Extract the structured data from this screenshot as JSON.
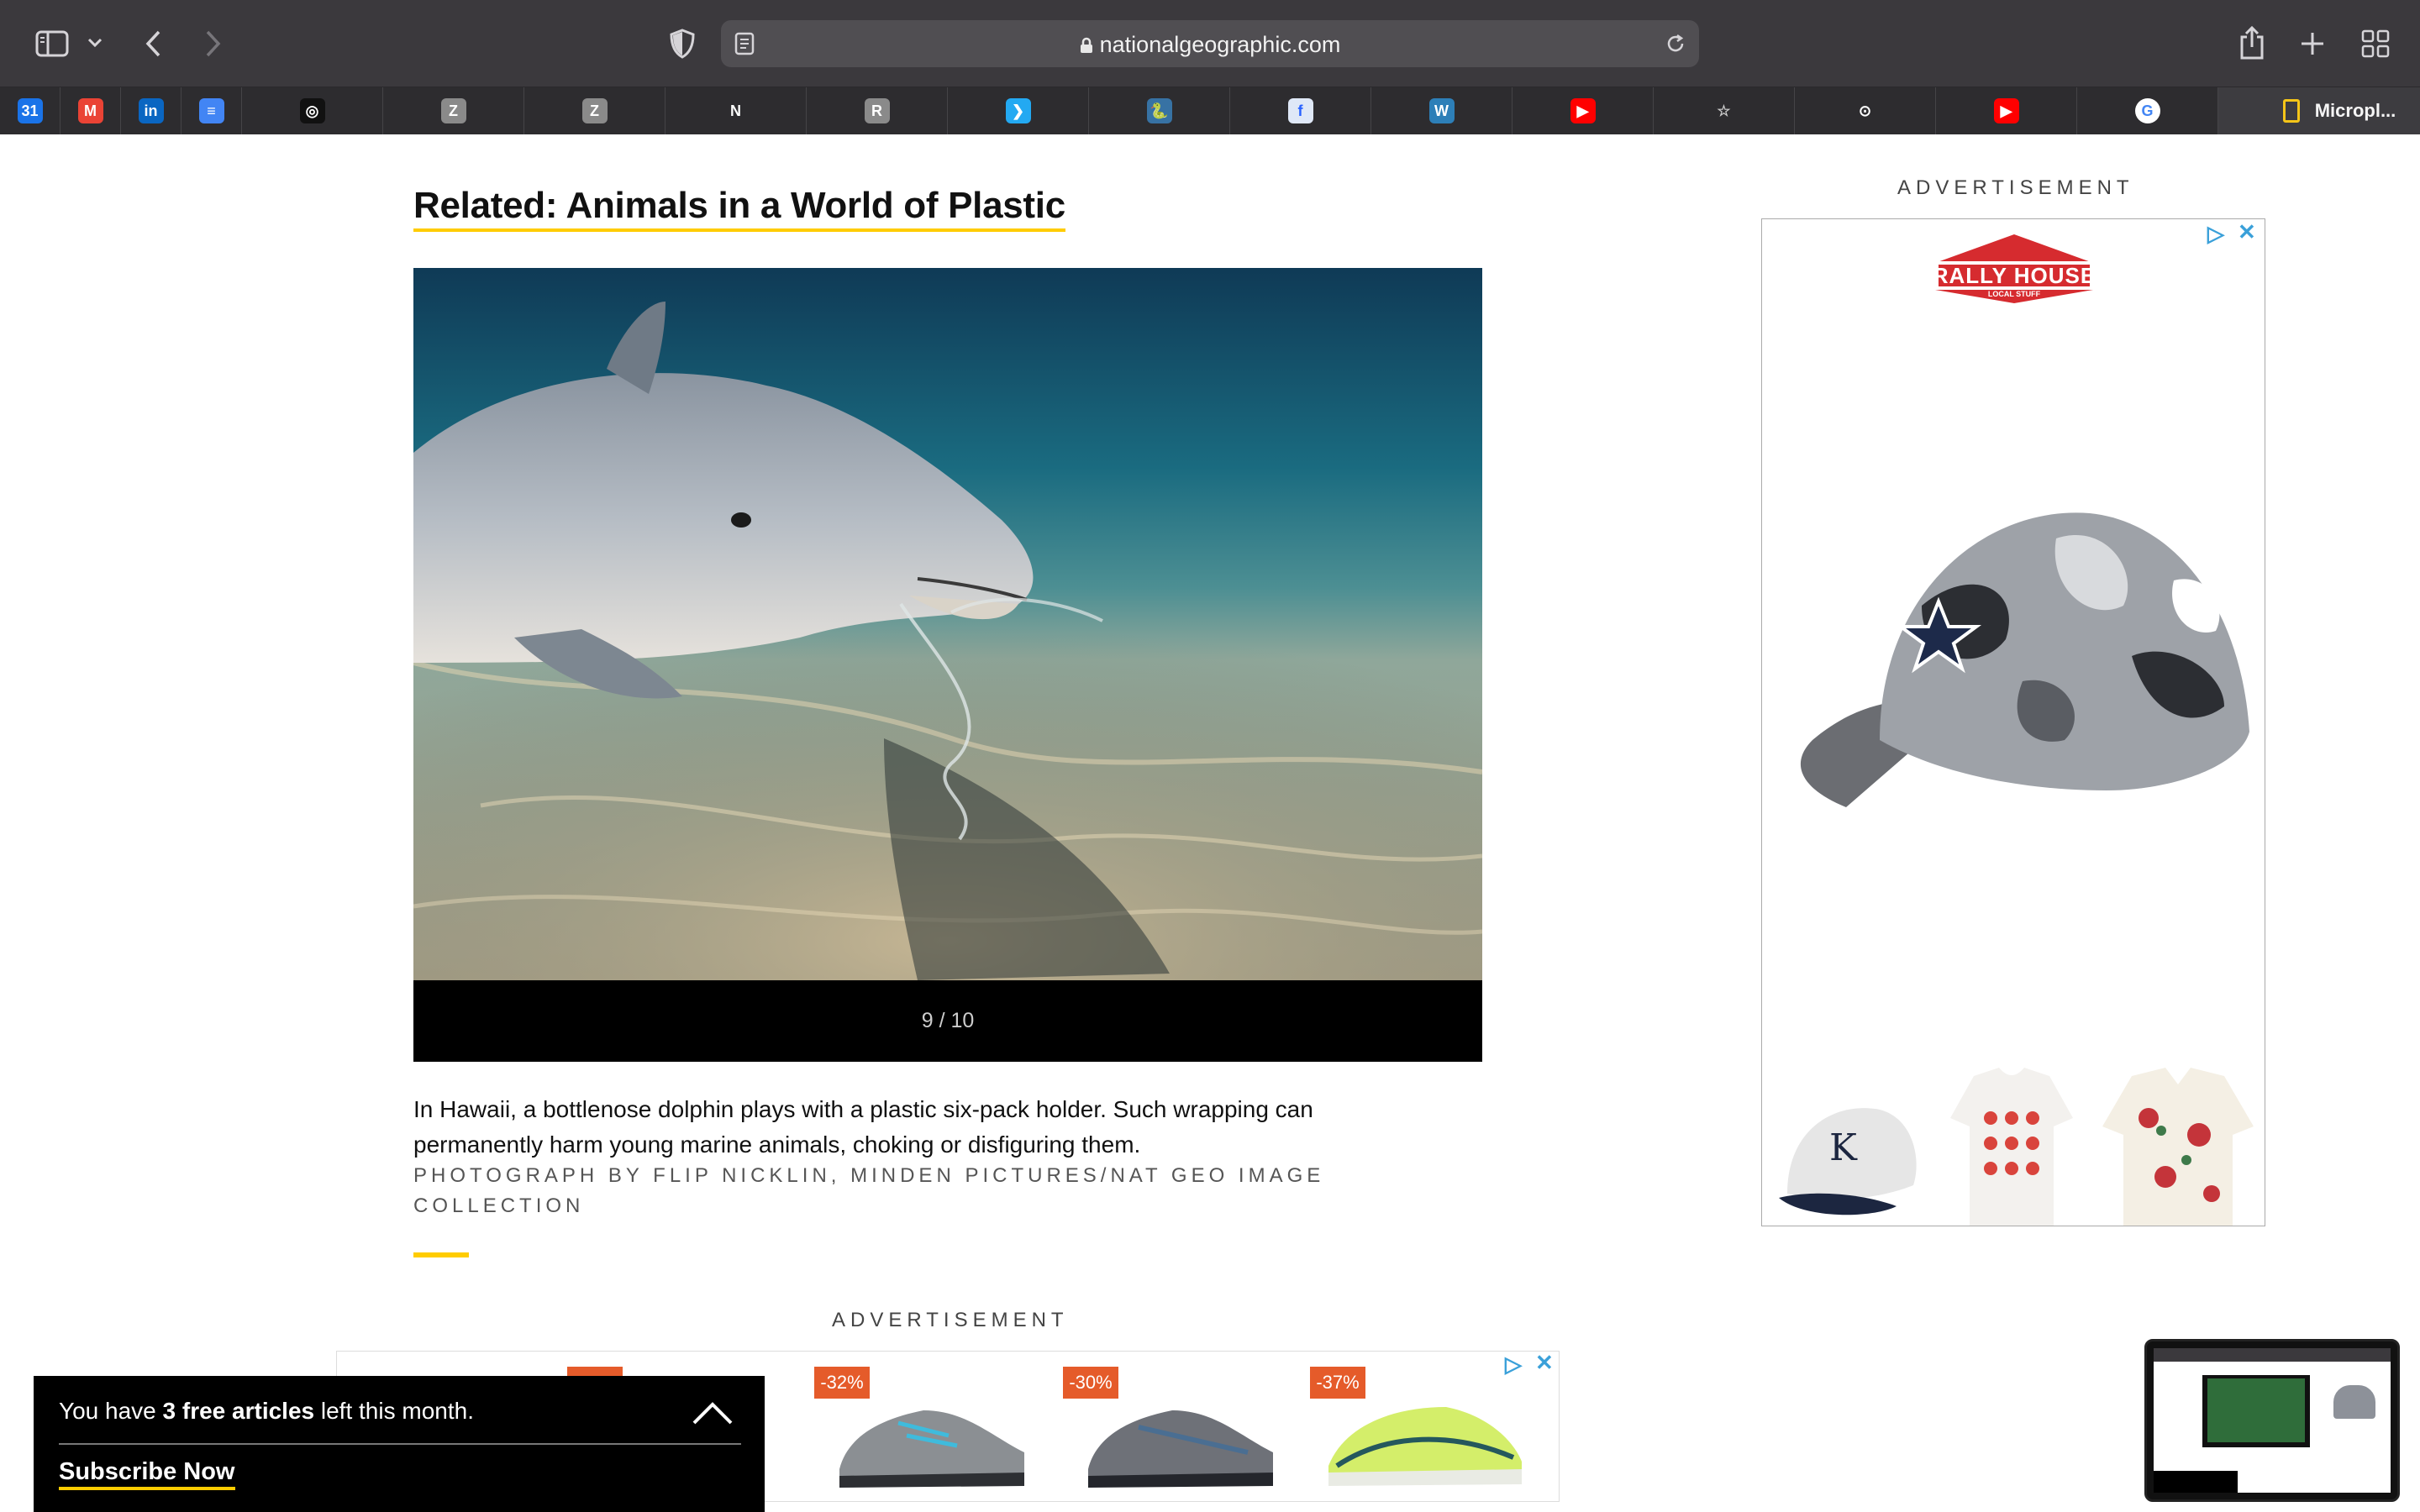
{
  "browser": {
    "url": "nationalgeographic.com",
    "favorites": [
      {
        "label": "31",
        "icon": "google-calendar-icon",
        "color": "#1a73e8"
      },
      {
        "label": "M",
        "icon": "gmail-icon",
        "color": "#ea4335"
      },
      {
        "label": "in",
        "icon": "linkedin-icon",
        "color": "#0a66c2"
      },
      {
        "label": "≡",
        "icon": "google-docs-icon",
        "color": "#4285f4"
      },
      {
        "label": "◎",
        "icon": "circle-app-icon",
        "color": "#111111"
      },
      {
        "label": "Z",
        "icon": "zotero-icon",
        "color": "#8a8a8a"
      },
      {
        "label": "Z",
        "icon": "zotero-icon",
        "color": "#8a8a8a"
      },
      {
        "label": "N",
        "icon": "notion-icon",
        "color": "#ffffff"
      },
      {
        "label": "R",
        "icon": "r-app-icon",
        "color": "#8a8a8a"
      },
      {
        "label": "❯",
        "icon": "vscode-icon",
        "color": "#23a9f2"
      },
      {
        "label": "🐍",
        "icon": "python-icon",
        "color": "#3772a4"
      },
      {
        "label": "f",
        "icon": "info-app-icon",
        "color": "#dfe8f7"
      },
      {
        "label": "W",
        "icon": "wordpress-icon",
        "color": "#2d7fb8"
      },
      {
        "label": "▶",
        "icon": "youtube-icon",
        "color": "#ff0000"
      },
      {
        "label": "☆",
        "icon": "star-icon",
        "color": "#2d2c2f"
      },
      {
        "label": "⊙",
        "icon": "github-icon",
        "color": "#ffffff"
      },
      {
        "label": "▶",
        "icon": "youtube-icon",
        "color": "#ff0000"
      },
      {
        "label": "G",
        "icon": "google-icon",
        "color": "#ffffff"
      }
    ],
    "active_tab_label": "Micropl..."
  },
  "article": {
    "related_title": "Related: Animals in a World of Plastic",
    "gallery_counter": "9 / 10",
    "caption": "In Hawaii, a bottlenose dolphin plays with a plastic six-pack holder. Such wrapping can permanently harm young marine animals, choking or disfiguring them.",
    "credit": "PHOTOGRAPH BY FLIP NICKLIN, MINDEN PICTURES/NAT GEO IMAGE COLLECTION"
  },
  "ads": {
    "label_right": "ADVERTISEMENT",
    "label_bottom": "ADVERTISEMENT",
    "rally_house": {
      "name": "RALLY HOUSE",
      "tagline": "LOCAL STUFF"
    },
    "discounts": [
      "",
      "-32%",
      "-30%",
      "-37%"
    ]
  },
  "paywall": {
    "prefix": "You have ",
    "count": "3 free articles",
    "suffix": " left this month.",
    "subscribe": "Subscribe Now"
  },
  "colors": {
    "accent": "#ffcc00",
    "toolbar": "#3b393d",
    "badge": "#e55b2a"
  }
}
